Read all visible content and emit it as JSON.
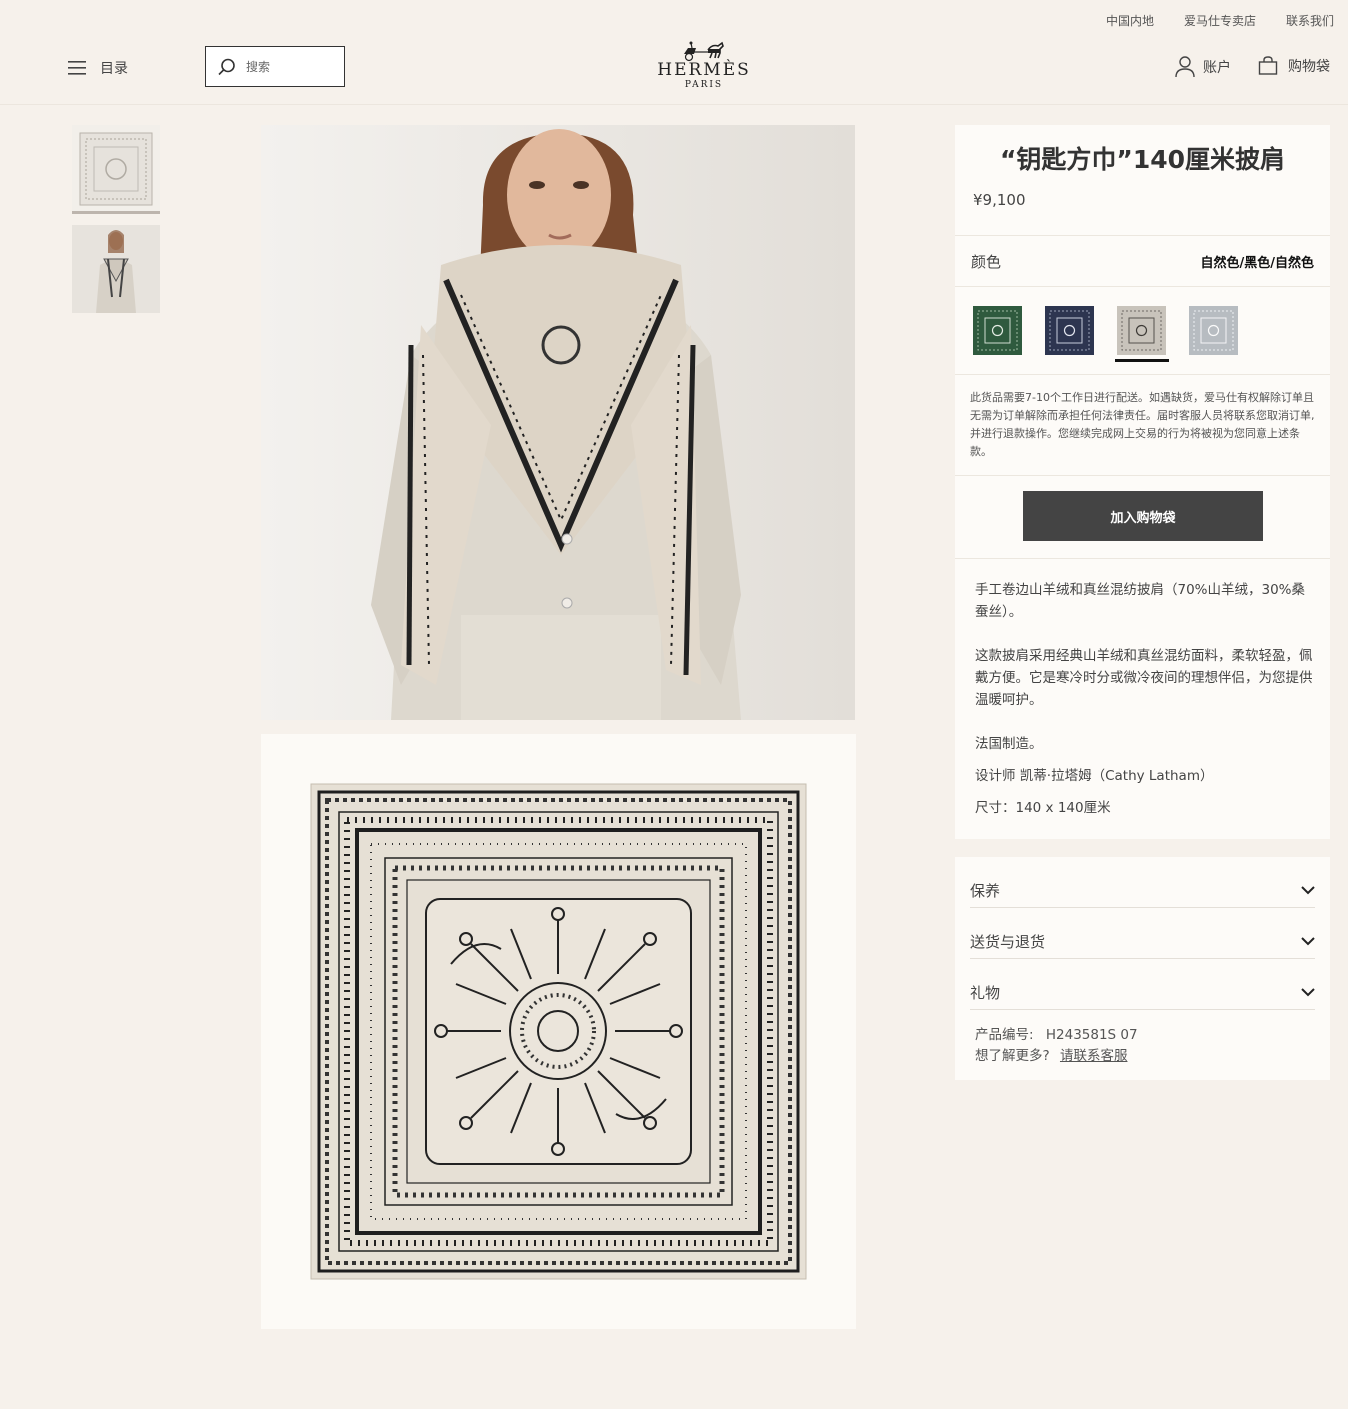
{
  "header": {
    "util_links": [
      "中国内地",
      "爱马仕专卖店",
      "联系我们"
    ],
    "menu_label": "目录",
    "search_placeholder": "搜索",
    "logo_text": "HERMÈS",
    "logo_city": "PARIS",
    "account_label": "账户",
    "bag_label": "购物袋"
  },
  "product": {
    "title": "“钥匙方巾”140厘米披肩",
    "price": "¥9,100",
    "color_label": "颜色",
    "color_value": "自然色/黑色/自然色",
    "swatches": [
      {
        "name": "green",
        "color": "#2f5a3e"
      },
      {
        "name": "navy",
        "color": "#2d3550"
      },
      {
        "name": "natural",
        "color": "#c8c3bb",
        "selected": true
      },
      {
        "name": "light-grey",
        "color": "#b7bcc1"
      }
    ],
    "notice": "此货品需要7-10个工作日进行配送。如遇缺货，爱马仕有权解除订单且无需为订单解除而承担任何法律责任。届时客服人员将联系您取消订单,并进行退款操作。您继续完成网上交易的行为将被视为您同意上述条款。",
    "add_to_bag": "加入购物袋",
    "desc_1": "手工卷边山羊绒和真丝混纺披肩（70%山羊绒，30%桑蚕丝）。",
    "desc_2": "这款披肩采用经典山羊绒和真丝混纺面料，柔软轻盈，佩戴方便。它是寒冷时分或微冷夜间的理想伴侣，为您提供温暖呵护。",
    "desc_3": "法国制造。",
    "designer": "设计师  凯蒂·拉塔姆（Cathy Latham）",
    "size": "尺寸：140 x 140厘米"
  },
  "accordion": [
    "保养",
    "送货与退货",
    "礼物"
  ],
  "meta": {
    "sku_label": "产品编号:",
    "sku": "H243581S 07",
    "help_text": "想了解更多?",
    "help_link": "请联系客服"
  }
}
